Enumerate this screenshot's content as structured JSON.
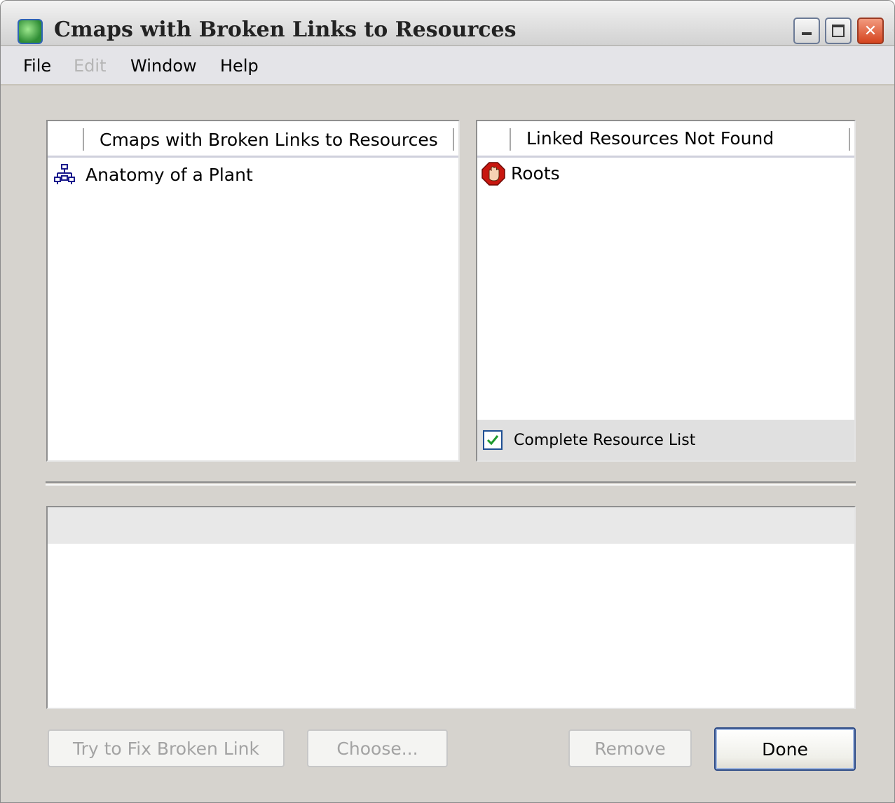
{
  "window": {
    "title": "Cmaps with Broken Links to Resources"
  },
  "menu": [
    {
      "label": "File",
      "enabled": true
    },
    {
      "label": "Edit",
      "enabled": false
    },
    {
      "label": "Window",
      "enabled": true
    },
    {
      "label": "Help",
      "enabled": true
    }
  ],
  "left_panel": {
    "header": "Cmaps with Broken Links to Resources",
    "items": [
      {
        "label": "Anatomy of a Plant",
        "icon": "cmap-icon"
      }
    ]
  },
  "right_panel": {
    "header": "Linked Resources Not Found",
    "items": [
      {
        "label": "Roots",
        "icon": "stop-hand-icon"
      }
    ],
    "checkbox": {
      "label": "Complete Resource List",
      "checked": true
    }
  },
  "buttons": {
    "fix": "Try to Fix Broken Link",
    "choose": "Choose...",
    "remove": "Remove",
    "done": "Done"
  }
}
